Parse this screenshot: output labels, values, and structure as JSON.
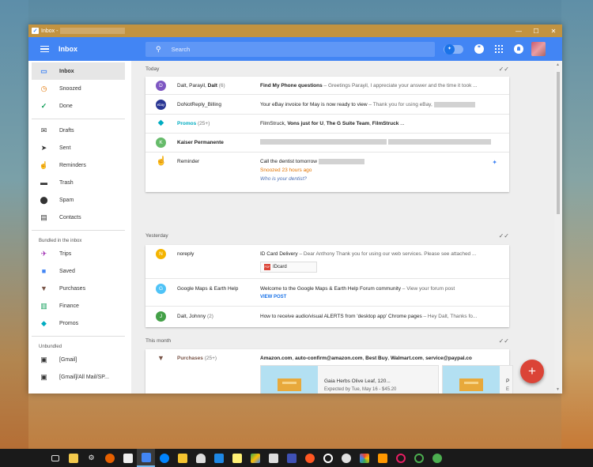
{
  "window": {
    "title": "Inbox -",
    "controls": [
      "—",
      "☐",
      "✕"
    ]
  },
  "appbar": {
    "title": "Inbox",
    "search_placeholder": "Search"
  },
  "sidebar": {
    "primary": [
      {
        "label": "Inbox",
        "icon": "inbox-icon",
        "glyph": "▭",
        "color": "#4285f4"
      },
      {
        "label": "Snoozed",
        "icon": "clock-icon",
        "glyph": "◷",
        "color": "#e37400"
      },
      {
        "label": "Done",
        "icon": "check-icon",
        "glyph": "✓",
        "color": "#0f9d58"
      }
    ],
    "secondary": [
      {
        "label": "Drafts",
        "icon": "drafts-icon",
        "glyph": "✉"
      },
      {
        "label": "Sent",
        "icon": "send-icon",
        "glyph": "➤"
      },
      {
        "label": "Reminders",
        "icon": "reminder-icon",
        "glyph": "☝"
      },
      {
        "label": "Trash",
        "icon": "trash-icon",
        "glyph": "🗑"
      },
      {
        "label": "Spam",
        "icon": "spam-icon",
        "glyph": "⚠"
      },
      {
        "label": "Contacts",
        "icon": "contacts-icon",
        "glyph": "▤"
      }
    ],
    "bundled_label": "Bundled in the inbox",
    "bundled": [
      {
        "label": "Trips",
        "icon": "plane-icon",
        "glyph": "✈",
        "color": "#9c27b0"
      },
      {
        "label": "Saved",
        "icon": "bookmark-icon",
        "glyph": "■",
        "color": "#4285f4"
      },
      {
        "label": "Purchases",
        "icon": "cart-icon",
        "glyph": "🛒",
        "color": "#795548"
      },
      {
        "label": "Finance",
        "icon": "chart-icon",
        "glyph": "▥",
        "color": "#0f9d58"
      },
      {
        "label": "Promos",
        "icon": "tag-icon",
        "glyph": "◆",
        "color": "#00acc1"
      }
    ],
    "unbundled_label": "Unbundled",
    "unbundled": [
      {
        "label": "[Gmail]",
        "icon": "label-icon",
        "glyph": "▣"
      },
      {
        "label": "[Gmail]/All Mail/SP...",
        "icon": "label-icon",
        "glyph": "▣"
      }
    ]
  },
  "today": {
    "label": "Today",
    "rows": [
      {
        "avatar": "D",
        "avatar_color": "#7e57c2",
        "sender_pre": "Dalt, Parayil, ",
        "sender_bold": "Dalt",
        "count": "(6)",
        "subject": "Find My Phone questions",
        "snippet": " – Greetings Parayil, I appreciate your answer and the time it took ..."
      },
      {
        "avatar": "ebay",
        "avatar_color": "#283593",
        "sender": "DoNotReply_Billing",
        "subject": "Your eBay invoice for May is now ready to view",
        "snippet": " – Thank you for using eBay,"
      },
      {
        "sender": "Promos",
        "count": "(25+)",
        "text1": "FilmStruck, ",
        "b1": "Vons just for U",
        "text2": ", ",
        "b2": "The G Suite Team",
        "text3": ", ",
        "b3": "FilmStruck",
        "text4": " ..."
      },
      {
        "avatar": "K",
        "avatar_color": "#66bb6a",
        "sender": "Kaiser Permanente"
      },
      {
        "sender": "Reminder",
        "subject": "Call the dentist tomorrow",
        "snoozed": "Snoozed 23 hours ago",
        "link": "Who is your dentist?"
      }
    ]
  },
  "yesterday": {
    "label": "Yesterday",
    "rows": [
      {
        "avatar": "N",
        "avatar_color": "#f4b400",
        "sender": "noreply",
        "subject": "ID Card Delivery",
        "snippet": " – Dear Anthony Thank you for using our web services. Please see attached ...",
        "attachment": "IDcard",
        "attachment_type": "PDF"
      },
      {
        "avatar": "G",
        "avatar_color": "#4fc3f7",
        "sender": "Google Maps & Earth Help",
        "subject": "Welcome to the Google Maps & Earth Help Forum community",
        "snippet": " – View your forum post",
        "action": "VIEW POST"
      },
      {
        "avatar": "J",
        "avatar_color": "#43a047",
        "sender": "Dalt, Johnny",
        "count": "(2)",
        "subject": "How to receive audio/visual ALERTS from 'desktop app' Chrome pages",
        "snippet": " – Hey Dalt, Thanks fo..."
      }
    ]
  },
  "this_month": {
    "label": "This month",
    "purchases": {
      "sender": "Purchases",
      "count": "(25+)",
      "b1": "Amazon.com",
      "t1": ", ",
      "b2": "auto-confirm@amazon.com",
      "t2": ", ",
      "b3": "Best Buy",
      "t3": ", ",
      "b4": "Walmart.com",
      "t4": ", ",
      "b5": "service@paypal.co",
      "item_title": "Gaia Herbs Olive Leaf, 120...",
      "item_sub": "Expected by Tue, May 16 - $45.20",
      "item2_title": "P",
      "item2_sub": "E"
    }
  },
  "fab": "+"
}
